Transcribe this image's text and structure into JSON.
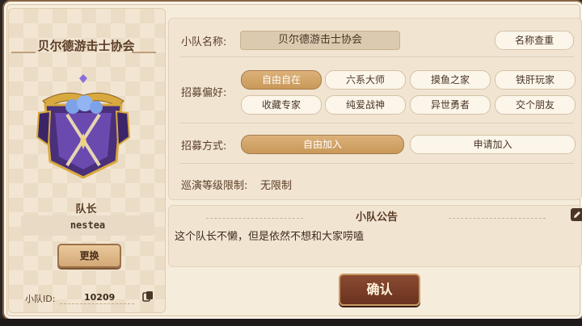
{
  "guild": {
    "name": "贝尔德游击士协会",
    "leader_label": "队长",
    "leader_name": "nestea",
    "change_button": "更换",
    "team_id_label": "小队ID:",
    "team_id": "10209"
  },
  "settings": {
    "team_name_label": "小队名称:",
    "team_name_value": "贝尔德游击士协会",
    "name_check_button": "名称查重",
    "preference_label": "招募偏好:",
    "preferences": [
      "自由自在",
      "六系大师",
      "摸鱼之家",
      "铁肝玩家",
      "收藏专家",
      "纯爱战神",
      "异世勇者",
      "交个朋友"
    ],
    "selected_preference": "自由自在",
    "method_label": "招募方式:",
    "methods": [
      "自由加入",
      "申请加入"
    ],
    "selected_method": "自由加入",
    "level_limit_label": "巡演等级限制:",
    "level_limit_value": "无限制"
  },
  "announcement": {
    "title": "小队公告",
    "text": "这个队长不懒，但是依然不想和大家唠嗑"
  },
  "confirm_button": "确认",
  "colors": {
    "panel_bg": "#f6ecdc",
    "selected_pill": "#c89858",
    "confirm_bg": "#7a3d26",
    "text_brown": "#5b3d27"
  }
}
